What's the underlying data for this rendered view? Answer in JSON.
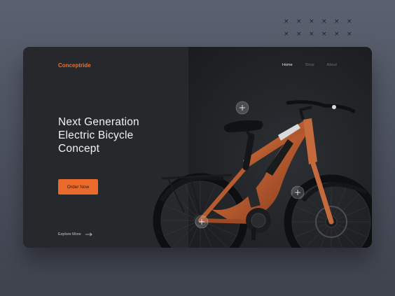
{
  "brand": {
    "name": "Conceptride",
    "accent_color": "#ea6a2c"
  },
  "nav": {
    "items": [
      {
        "label": "Home",
        "active": true
      },
      {
        "label": "Shop",
        "active": false
      },
      {
        "label": "About",
        "active": false
      }
    ]
  },
  "hero": {
    "headline_lines": [
      "Next Generation",
      "Electric Bicycle",
      "Concept"
    ],
    "cta_label": "Order Now",
    "explore_label": "Explore More",
    "explore_icon": "arrow-right-icon"
  },
  "product_image": {
    "icon": "electric-bicycle-image",
    "hotspot_icon": "plus-icon"
  },
  "decoration": {
    "glyph": "×"
  }
}
